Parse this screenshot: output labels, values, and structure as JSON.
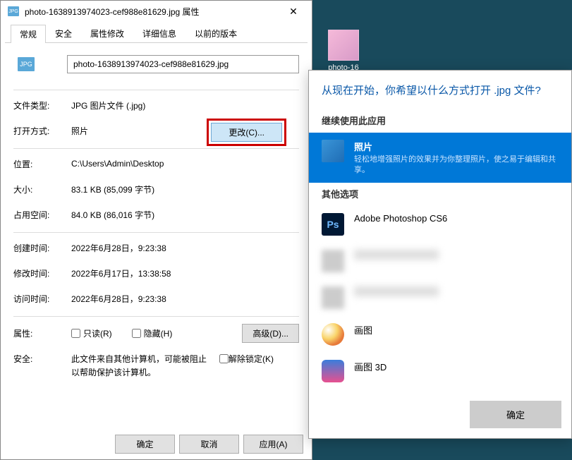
{
  "properties": {
    "title": "photo-1638913974023-cef988e81629.jpg 属性",
    "tabs": [
      "常规",
      "安全",
      "属性修改",
      "详细信息",
      "以前的版本"
    ],
    "filename": "photo-1638913974023-cef988e81629.jpg",
    "labels": {
      "file_type": "文件类型:",
      "open_with": "打开方式:",
      "location": "位置:",
      "size": "大小:",
      "size_on_disk": "占用空间:",
      "created": "创建时间:",
      "modified": "修改时间:",
      "accessed": "访问时间:",
      "attributes": "属性:",
      "security": "安全:"
    },
    "values": {
      "file_type": "JPG 图片文件 (.jpg)",
      "open_with": "照片",
      "change_btn": "更改(C)...",
      "location": "C:\\Users\\Admin\\Desktop",
      "size": "83.1 KB (85,099 字节)",
      "size_on_disk": "84.0 KB (86,016 字节)",
      "created": "2022年6月28日，9:23:38",
      "modified": "2022年6月17日，13:38:58",
      "accessed": "2022年6月28日，9:23:38",
      "readonly": "只读(R)",
      "hidden": "隐藏(H)",
      "advanced": "高级(D)...",
      "security_text": "此文件来自其他计算机，可能被阻止以帮助保护该计算机。",
      "unblock": "解除锁定(K)"
    },
    "buttons": {
      "ok": "确定",
      "cancel": "取消",
      "apply": "应用(A)"
    },
    "icon_badge": "JPG"
  },
  "desktop_icon": {
    "label": "photo-16"
  },
  "openwith": {
    "title": "从现在开始，你希望以什么方式打开 .jpg 文件?",
    "continue_label": "继续使用此应用",
    "photos": {
      "name": "照片",
      "desc": "轻松地增强照片的效果并为你整理照片，使之易于编辑和共享。"
    },
    "other_label": "其他选项",
    "apps": {
      "photoshop": "Adobe Photoshop CS6",
      "paint": "画图",
      "paint3d": "画图 3D"
    },
    "ok": "确定"
  }
}
